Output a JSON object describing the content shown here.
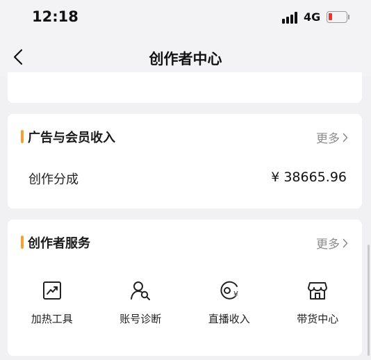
{
  "status_bar": {
    "time": "12:18",
    "network": "4G",
    "battery_level_percent": 10,
    "battery_color": "#e53935"
  },
  "nav": {
    "title": "创作者中心",
    "back_icon": "chevron-left-icon"
  },
  "top_card": {
    "clipped_items": [
      "",
      "",
      "",
      ""
    ]
  },
  "income_section": {
    "title": "广告与会员收入",
    "more_label": "更多",
    "rows": [
      {
        "label": "创作分成",
        "value": "¥ 38665.96"
      }
    ]
  },
  "service_section": {
    "title": "创作者服务",
    "more_label": "更多",
    "items": [
      {
        "label": "加热工具",
        "icon": "trend-chart-icon"
      },
      {
        "label": "账号诊断",
        "icon": "user-search-icon"
      },
      {
        "label": "直播收入",
        "icon": "live-income-icon"
      },
      {
        "label": "带货中心",
        "icon": "store-icon"
      }
    ]
  },
  "colors": {
    "accent": "#f0a23c",
    "background": "#f1f1f3",
    "card": "#ffffff",
    "muted_text": "#8c8c8c"
  }
}
